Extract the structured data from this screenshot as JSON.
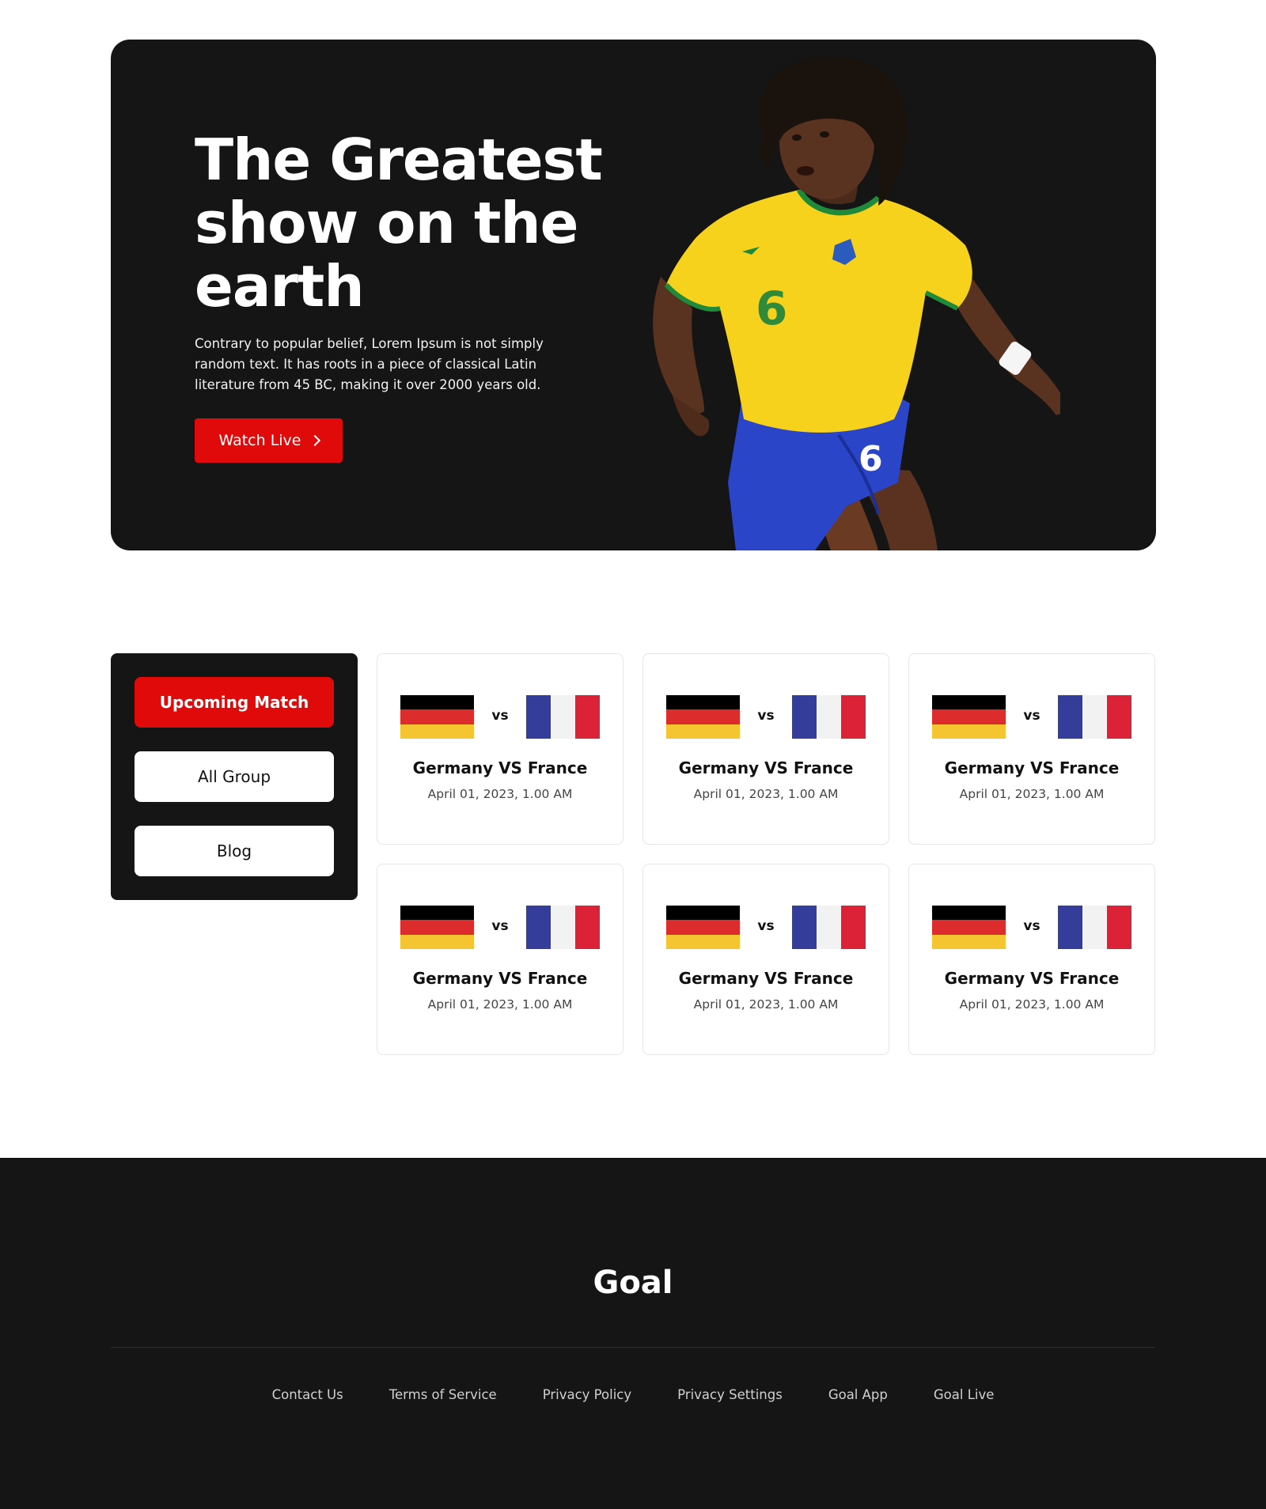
{
  "hero": {
    "title": "The Greatest show on the earth",
    "description": "Contrary to popular belief, Lorem Ipsum is not simply random text. It has roots in a piece of classical Latin literature from 45 BC, making it over 2000 years old.",
    "cta_label": "Watch Live",
    "cta_icon": "chevron-right-icon",
    "player_image": "football-player-in-yellow-jersey-number-6",
    "player_jersey_number": "6"
  },
  "sidebar": {
    "items": [
      {
        "label": "Upcoming Match",
        "active": true
      },
      {
        "label": "All Group",
        "active": false
      },
      {
        "label": "Blog",
        "active": false
      }
    ]
  },
  "matches": [
    {
      "home": "Germany",
      "away": "France",
      "vs": "vs",
      "title": "Germany VS France",
      "date": "April 01, 2023, 1.00 AM"
    },
    {
      "home": "Germany",
      "away": "France",
      "vs": "vs",
      "title": "Germany VS France",
      "date": "April 01, 2023, 1.00 AM"
    },
    {
      "home": "Germany",
      "away": "France",
      "vs": "vs",
      "title": "Germany VS France",
      "date": "April 01, 2023, 1.00 AM"
    },
    {
      "home": "Germany",
      "away": "France",
      "vs": "vs",
      "title": "Germany VS France",
      "date": "April 01, 2023, 1.00 AM"
    },
    {
      "home": "Germany",
      "away": "France",
      "vs": "vs",
      "title": "Germany VS France",
      "date": "April 01, 2023, 1.00 AM"
    },
    {
      "home": "Germany",
      "away": "France",
      "vs": "vs",
      "title": "Germany VS France",
      "date": "April 01, 2023, 1.00 AM"
    }
  ],
  "footer": {
    "logo": "Goal",
    "links": [
      "Contact Us",
      "Terms of Service",
      "Privacy Policy",
      "Privacy Settings",
      "Goal App",
      "Goal Live"
    ]
  },
  "colors": {
    "accent": "#e00a0a",
    "dark_bg": "#151515",
    "card_border": "#e6e6e6",
    "germany": [
      "#000000",
      "#dd2c2c",
      "#f4c531"
    ],
    "france": [
      "#343d99",
      "#f2f2f2",
      "#dc2237"
    ]
  }
}
